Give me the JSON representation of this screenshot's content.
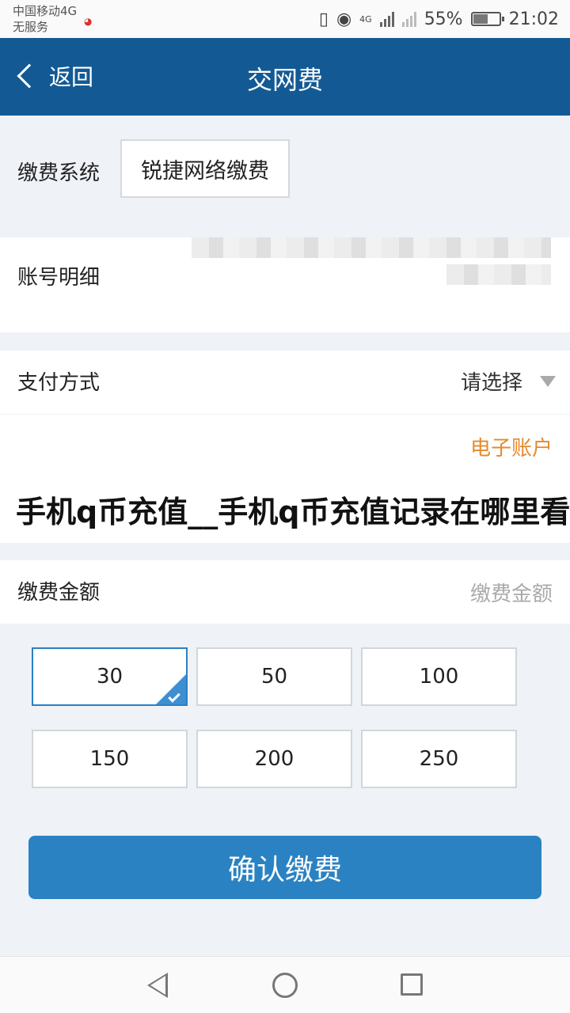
{
  "status_bar": {
    "carrier": "中国移动4G",
    "service": "无服务",
    "network": "4G",
    "battery": "55%",
    "time": "21:02"
  },
  "header": {
    "back_label": "返回",
    "title": "交网费"
  },
  "form": {
    "system_label": "缴费系统",
    "system_value": "锐捷网络缴费",
    "account_label": "账号明细",
    "payment_label": "支付方式",
    "payment_value": "请选择",
    "payment_option": "电子账户",
    "amount_label": "缴费金额",
    "amount_placeholder": "缴费金额"
  },
  "amounts": [
    "30",
    "50",
    "100",
    "150",
    "200",
    "250"
  ],
  "selected_amount": "30",
  "confirm_label": "确认缴费",
  "watermark": "手机q币充值__手机q币充值记录在哪里看",
  "colors": {
    "header": "#135a95",
    "accent": "#2a82c2",
    "option": "#e48a2e"
  }
}
